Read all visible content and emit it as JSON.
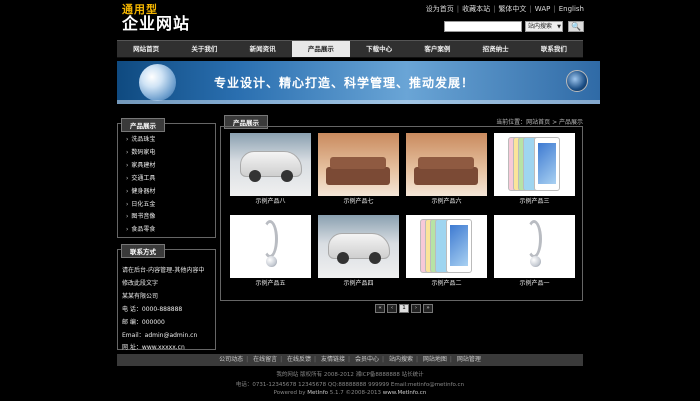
{
  "logo": {
    "line1": "通用型",
    "line2": "企业网站"
  },
  "toplinks": [
    "设为首页",
    "收藏本站",
    "繁体中文",
    "WAP",
    "English"
  ],
  "search": {
    "placeholder": "",
    "select_label": "站内搜索",
    "button": "🔍"
  },
  "nav": [
    "网站首页",
    "关于我们",
    "新闻资讯",
    "产品展示",
    "下载中心",
    "客户案例",
    "招贤纳士",
    "联系我们"
  ],
  "nav_active_index": 3,
  "banner": {
    "slogan": "专业设计、精心打造、科学管理、推动发展！"
  },
  "categories": {
    "title": "产品展示",
    "items": [
      "洗品珠宝",
      "数码家电",
      "家具建材",
      "交通工具",
      "健身器材",
      "日化五金",
      "图书音像",
      "食品零食"
    ]
  },
  "contact": {
    "title": "联系方式",
    "lines": [
      "请在后台-内容管理-其他内容中",
      "修改此段文字",
      "某某有限公司",
      "电  话：0000-888888",
      "邮  编：000000",
      "Email：admin@admin.cn",
      "网  址：www.xxxxx.cn"
    ]
  },
  "products": {
    "title": "产品展示",
    "breadcrumb": "当前位置：网站首页 > 产品展示",
    "items": [
      {
        "name": "示例产品八",
        "kind": "car"
      },
      {
        "name": "示例产品七",
        "kind": "sofa"
      },
      {
        "name": "示例产品六",
        "kind": "sofa"
      },
      {
        "name": "示例产品三",
        "kind": "ipad"
      },
      {
        "name": "示例产品五",
        "kind": "pendant"
      },
      {
        "name": "示例产品四",
        "kind": "car"
      },
      {
        "name": "示例产品二",
        "kind": "ipad"
      },
      {
        "name": "示例产品一",
        "kind": "pendant"
      }
    ]
  },
  "pager": [
    "«",
    "‹",
    "1",
    "›",
    "»"
  ],
  "footer": {
    "links": [
      "公司动态",
      "在线留言",
      "在线反馈",
      "友情链接",
      "会员中心",
      "站内搜索",
      "网站地图",
      "网站管理"
    ],
    "line1": "我的网站 版权所有 2008-2012 湘ICP备8888888 站长统计",
    "line2": "电话：0731-12345678 12345678  QQ:88888888 999999 Email:metinfo@metinfo.cn",
    "line3_prefix": "Powered by ",
    "line3_brand": "MetInfo",
    "line3_mid": " 5.1.7 ©2008-2013 ",
    "line3_site": "www.MetInfo.cn"
  },
  "colors": {
    "background": "#000000",
    "logo_accent": "#f2b400",
    "nav": "#303030",
    "nav_active": "#e8e8e8",
    "banner": "#2a6fb0"
  }
}
